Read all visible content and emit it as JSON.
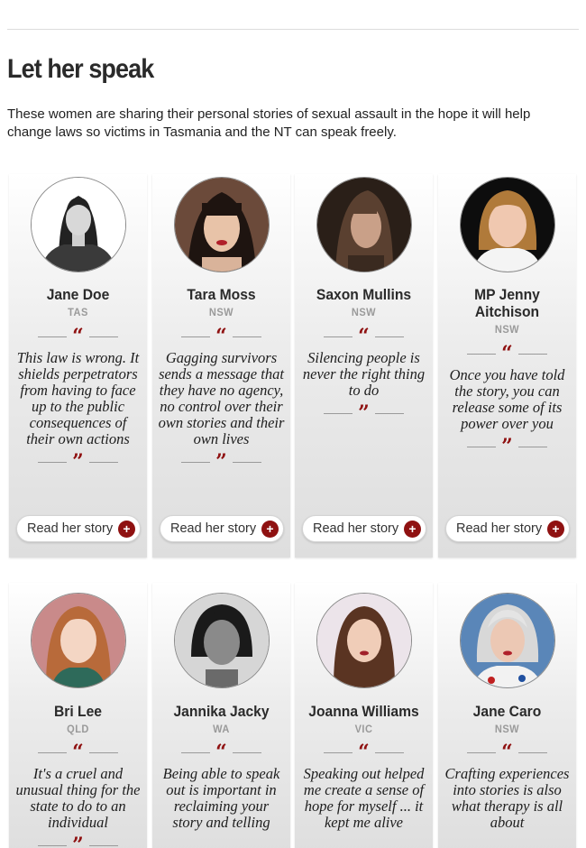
{
  "page": {
    "title": "Let her speak",
    "intro": "These women are sharing their personal stories of sexual assault in the hope it will help change laws so victims in Tasmania and the NT can speak freely."
  },
  "colors": {
    "accent": "#8f1111",
    "state_gray": "#9a9a9a"
  },
  "quote_glyphs": {
    "open": "“",
    "close": "”"
  },
  "cards": [
    {
      "name": "Jane Doe",
      "state": "TAS",
      "quote": "This law is wrong. It shields perpetrators from having to face up to the public consequences of their own actions",
      "button": "Read her story",
      "avatar_icon": "silhouette-avatar-icon"
    },
    {
      "name": "Tara Moss",
      "state": "NSW",
      "quote": "Gagging survivors sends a message that they have no agency, no control over their own stories and their own lives",
      "button": "Read her story",
      "avatar_icon": "portrait-photo"
    },
    {
      "name": "Saxon Mullins",
      "state": "NSW",
      "quote": "Silencing people is never the right thing to do",
      "button": "Read her story",
      "avatar_icon": "portrait-photo"
    },
    {
      "name": "MP Jenny Aitchison",
      "state": "NSW",
      "quote": "Once you have told the story, you can release some of its power over you",
      "button": "Read her story",
      "avatar_icon": "portrait-photo"
    },
    {
      "name": "Bri Lee",
      "state": "QLD",
      "quote": "It's a cruel and unusual thing for the state to do to an individual",
      "avatar_icon": "portrait-photo"
    },
    {
      "name": "Jannika Jacky",
      "state": "WA",
      "quote": "Being able to speak out is important in reclaiming your story and telling",
      "avatar_icon": "portrait-photo"
    },
    {
      "name": "Joanna Williams",
      "state": "VIC",
      "quote": "Speaking out helped me create a sense of hope for myself ... it kept me alive",
      "avatar_icon": "portrait-photo"
    },
    {
      "name": "Jane Caro",
      "state": "NSW",
      "quote": "Crafting experiences into stories is also what therapy is all about",
      "avatar_icon": "portrait-photo"
    }
  ]
}
